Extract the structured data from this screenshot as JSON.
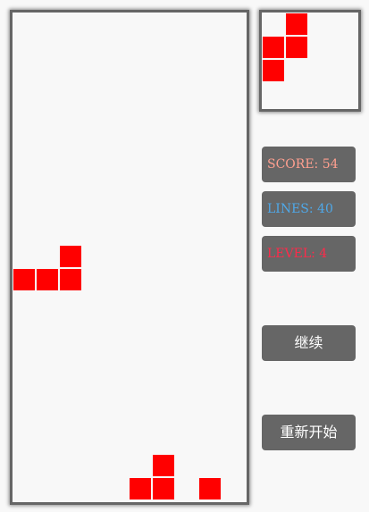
{
  "colors": {
    "block": "#ff0000",
    "panel": "#666666",
    "background": "#f8f8f8",
    "score_text": "#ff9f8f",
    "lines_text": "#4fa8e8",
    "level_text": "#ff2a4a"
  },
  "stats": {
    "score_label": "SCORE: 54",
    "lines_label": "LINES: 40",
    "level_label": "LEVEL: 4"
  },
  "buttons": {
    "continue_label": "继续",
    "restart_label": "重新开始"
  },
  "board": {
    "columns": 10,
    "rows": 21,
    "filled_cells": [
      {
        "col": 2,
        "row": 10
      },
      {
        "col": 0,
        "row": 11
      },
      {
        "col": 1,
        "row": 11
      },
      {
        "col": 2,
        "row": 11
      },
      {
        "col": 6,
        "row": 19
      },
      {
        "col": 5,
        "row": 20
      },
      {
        "col": 6,
        "row": 20
      },
      {
        "col": 8,
        "row": 20
      }
    ]
  },
  "next_piece": {
    "columns": 4,
    "rows": 4,
    "filled_cells": [
      {
        "col": 1,
        "row": 0
      },
      {
        "col": 0,
        "row": 1
      },
      {
        "col": 1,
        "row": 1
      },
      {
        "col": 0,
        "row": 2
      }
    ]
  }
}
